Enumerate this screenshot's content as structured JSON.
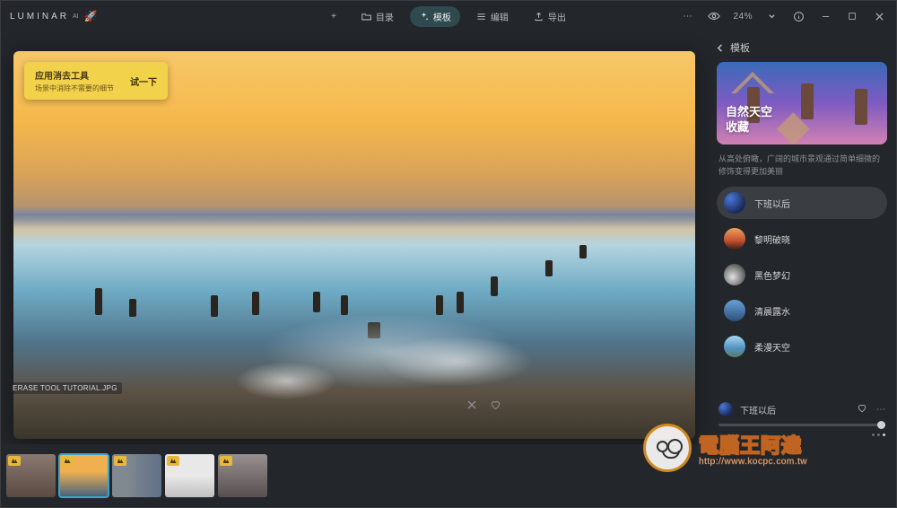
{
  "brand": {
    "name": "LUMINAR",
    "suffix": "AI",
    "rocket": "🚀"
  },
  "nav": {
    "add": "+",
    "catalog": {
      "label": "目录"
    },
    "templates": {
      "label": "模板"
    },
    "edit": {
      "label": "编辑"
    },
    "export": {
      "label": "导出"
    }
  },
  "titlebar": {
    "zoom": "24%",
    "dots": "⋯"
  },
  "tip": {
    "title": "应用消去工具",
    "body": "场景中消除不需要的细节",
    "action": "试一下"
  },
  "sidebar": {
    "back_label": "模板",
    "collection": {
      "line1": "自然天空",
      "line2": "收藏"
    },
    "description": "从高处俯瞰，广阔的城市景观通过简单细微的修饰变得更加美丽",
    "presets": [
      {
        "label": "下班以后",
        "thumb": "t0",
        "active": true
      },
      {
        "label": "黎明破晓",
        "thumb": "t1"
      },
      {
        "label": "黑色梦幻",
        "thumb": "t2"
      },
      {
        "label": "清晨露水",
        "thumb": "t3"
      },
      {
        "label": "柔漫天空",
        "thumb": "t4"
      }
    ],
    "selected": {
      "label": "下班以后"
    }
  },
  "filmstrip": {
    "filename": "ERASE TOOL TUTORIAL.JPG",
    "thumbs": [
      "th0",
      "th1",
      "th2",
      "th3",
      "th4"
    ],
    "selected_index": 1
  },
  "watermark": {
    "title": "電腦王阿達",
    "url": "http://www.kocpc.com.tw"
  }
}
